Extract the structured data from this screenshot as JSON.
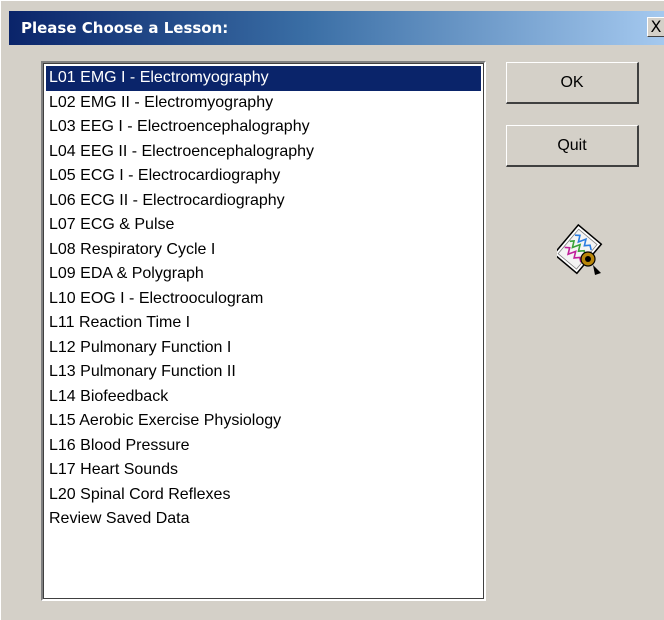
{
  "dialog": {
    "title": "Please Choose a Lesson:",
    "close_label": "X"
  },
  "lessons": {
    "selected_index": 0,
    "items": [
      "L01 EMG I - Electromyography",
      "L02 EMG II - Electromyography",
      "L03 EEG I - Electroencephalography",
      "L04 EEG II - Electroencephalography",
      "L05 ECG I - Electrocardiography",
      "L06 ECG II - Electrocardiography",
      "L07 ECG & Pulse",
      "L08 Respiratory Cycle I",
      "L09 EDA & Polygraph",
      "L10 EOG I - Electrooculogram",
      "L11 Reaction Time I",
      "L12 Pulmonary Function I",
      "L13 Pulmonary Function II",
      "L14 Biofeedback",
      "L15 Aerobic Exercise Physiology",
      "L16 Blood Pressure",
      "L17 Heart Sounds",
      "L20 Spinal Cord Reflexes",
      "Review Saved Data"
    ]
  },
  "buttons": {
    "ok_label": "OK",
    "quit_label": "Quit"
  },
  "icons": {
    "close": "close-icon",
    "app": "lesson-card-icon"
  },
  "colors": {
    "title_gradient_start": "#0a246a",
    "title_gradient_end": "#a6caf0",
    "selection": "#0a246a",
    "face": "#d4d0c8"
  }
}
